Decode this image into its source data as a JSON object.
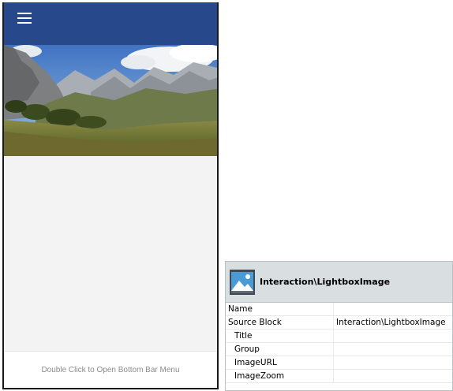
{
  "phone": {
    "menu_icon": "hamburger-menu-icon",
    "topbar_color": "#27498b",
    "hero_image": "mountain-landscape",
    "bottom_bar_text": "Double Click to Open Bottom Bar Menu"
  },
  "panel": {
    "icon": "image-icon",
    "title": "Interaction\\LightboxImage",
    "properties": [
      {
        "name": "Name",
        "value": ""
      },
      {
        "name": "Source Block",
        "value": "Interaction\\LightboxImage"
      },
      {
        "name": "Title",
        "value": ""
      },
      {
        "name": "Group",
        "value": ""
      },
      {
        "name": "ImageURL",
        "value": ""
      },
      {
        "name": "ImageZoom",
        "value": ""
      }
    ]
  }
}
